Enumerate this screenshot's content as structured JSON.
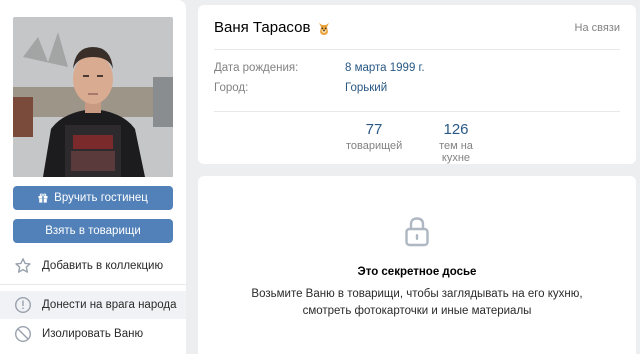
{
  "profile": {
    "name": "Ваня Тарасов",
    "status": "На связи",
    "emoji": "dog-emoji-icon",
    "birthday_label": "Дата рождения:",
    "birthday_value": "8 марта 1999 г.",
    "city_label": "Город:",
    "city_value": "Горький"
  },
  "counters": [
    {
      "value": "77",
      "label": "товарищей"
    },
    {
      "value": "126",
      "label": "тем на кухне"
    }
  ],
  "actions": {
    "gift_label": "Вручить гостинец",
    "friend_label": "Взять в товарищи"
  },
  "menu": [
    {
      "label": "Добавить в коллекцию",
      "icon": "star-icon"
    },
    {
      "label": "Донести на врага народа",
      "icon": "alert-icon"
    },
    {
      "label": "Изолировать Ваню",
      "icon": "block-icon"
    }
  ],
  "secret": {
    "title": "Это секретное досье",
    "text": "Возьмите Ваню в товарищи, чтобы заглядывать на его кухню, смотреть фотокарточки и иные материалы"
  },
  "colors": {
    "accent": "#5181b8",
    "link": "#2a5885",
    "background": "#edeef0"
  }
}
